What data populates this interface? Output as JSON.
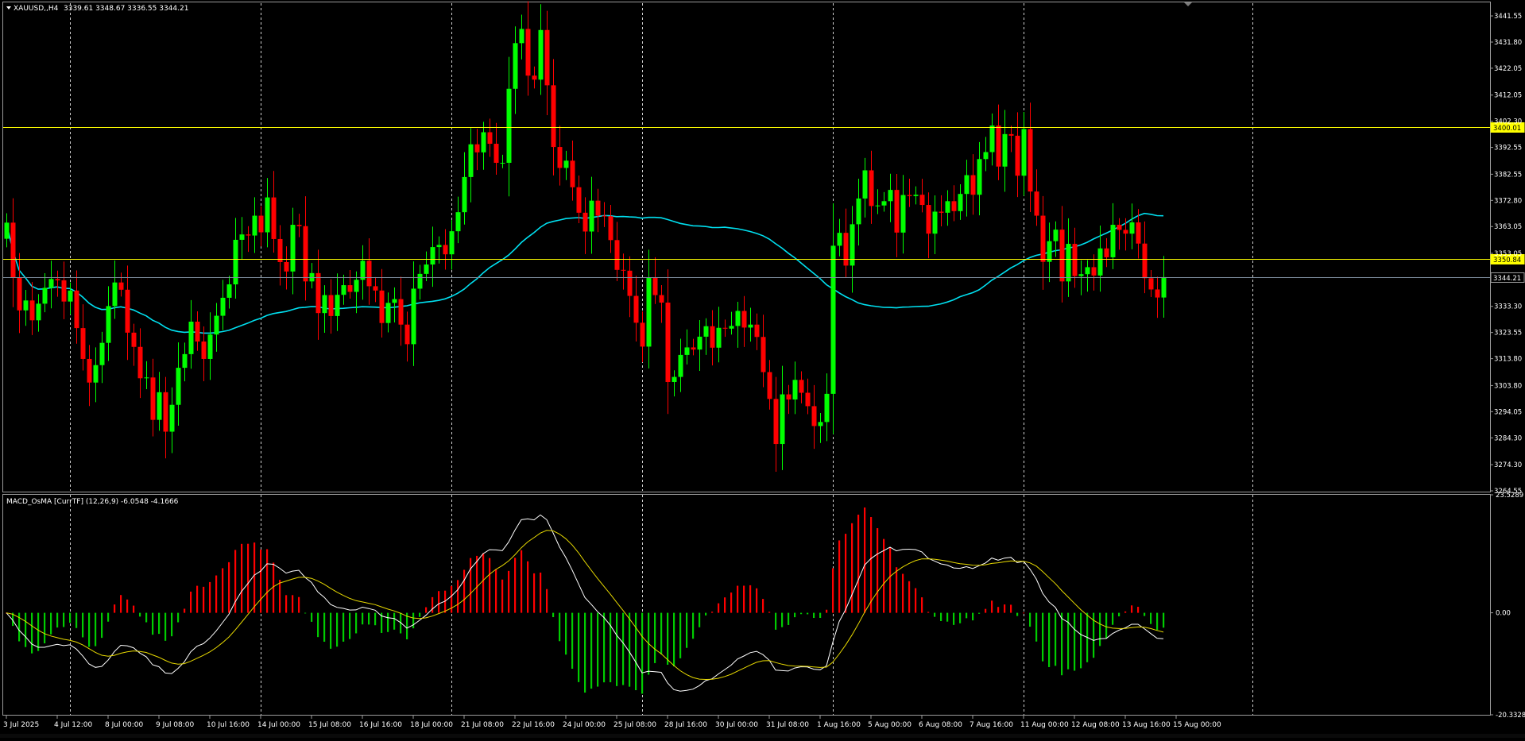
{
  "window": {
    "symbol_title": "XAUUSD,,H4",
    "ohlc_readout": "3339.61 3348.67 3336.55 3344.21"
  },
  "indicator": {
    "title": "MACD_OsMA [CurrTF] (12,26,9) -6.0548 -4.1666"
  },
  "colors": {
    "background": "#000000",
    "bull_candle": "#00ff00",
    "bear_candle": "#ff0000",
    "moving_average": "#00e0f0",
    "level_line": "#ffff00",
    "current_price_line": "#7d8d9d",
    "macd_line": "#ffffff",
    "signal_line": "#e6d800",
    "hist_positive": "#ff0000",
    "hist_negative": "#00cc00",
    "grid": "#cfcfcf",
    "axis_text": "#ffffff"
  },
  "chart_data": [
    {
      "type": "candlestick",
      "ylim": [
        3264.55,
        3446.3
      ],
      "ticks": [
        3441.55,
        3431.8,
        3422.05,
        3412.05,
        3402.3,
        3392.55,
        3382.55,
        3372.8,
        3363.05,
        3353.05,
        3333.3,
        3323.55,
        3313.8,
        3303.8,
        3294.05,
        3284.3,
        3274.3,
        3264.55
      ],
      "tick_labels": [
        "3441.55",
        "3431.80",
        "3422.05",
        "3412.05",
        "3402.30",
        "3392.55",
        "3382.55",
        "3372.80",
        "3363.05",
        "3353.05",
        "3333.30",
        "3323.55",
        "3313.80",
        "3303.80",
        "3294.05",
        "3284.30",
        "3274.30",
        "3264.55"
      ],
      "price_labels": [
        {
          "value": 3400.01,
          "text": "3400.01",
          "style": "level"
        },
        {
          "value": 3350.84,
          "text": "3350.84",
          "style": "level"
        },
        {
          "value": 3344.21,
          "text": "3344.21",
          "style": "current"
        }
      ],
      "x_labels": [
        "3 Jul 2025",
        "4 Jul 12:00",
        "8 Jul 00:00",
        "9 Jul 08:00",
        "10 Jul 16:00",
        "14 Jul 00:00",
        "15 Jul 08:00",
        "16 Jul 16:00",
        "18 Jul 00:00",
        "21 Jul 08:00",
        "22 Jul 16:00",
        "24 Jul 00:00",
        "25 Jul 08:00",
        "28 Jul 16:00",
        "30 Jul 00:00",
        "31 Jul 08:00",
        "1 Aug 16:00",
        "5 Aug 00:00",
        "6 Aug 08:00",
        "7 Aug 16:00",
        "11 Aug 00:00",
        "12 Aug 08:00",
        "13 Aug 16:00",
        "15 Aug 00:00"
      ],
      "x_label_bars": [
        0,
        8,
        16,
        24,
        32,
        40,
        48,
        56,
        64,
        72,
        80,
        88,
        96,
        104,
        112,
        120,
        128,
        136,
        144,
        152,
        160,
        168,
        176,
        184
      ],
      "grid_bars": [
        10,
        40,
        70,
        100,
        130,
        160,
        196
      ],
      "total_slots": 239,
      "bar_count": 186,
      "closes": [
        3364.5,
        3344.1,
        3331.8,
        3335.5,
        3328.1,
        3334.3,
        3340.2,
        3343.5,
        3343.0,
        3335.1,
        3339.2,
        3325.2,
        3313.7,
        3304.9,
        3311.4,
        3319.7,
        3333.4,
        3342.2,
        3339.5,
        3323.5,
        3318.2,
        3306.5,
        3306.8,
        3291.0,
        3301.3,
        3286.6,
        3296.6,
        3310.4,
        3315.5,
        3327.6,
        3320.2,
        3313.7,
        3322.8,
        3329.8,
        3336.5,
        3341.5,
        3358.1,
        3360.1,
        3359.7,
        3367.1,
        3360.9,
        3373.9,
        3358.4,
        3349.8,
        3346.3,
        3363.7,
        3363.2,
        3342.6,
        3345.7,
        3330.8,
        3337.5,
        3329.7,
        3337.6,
        3341.2,
        3338.7,
        3343.2,
        3350.3,
        3340.8,
        3339.2,
        3327.1,
        3334.6,
        3336.0,
        3326.5,
        3319.2,
        3339.9,
        3345.4,
        3348.9,
        3355.4,
        3356.2,
        3352.7,
        3361.3,
        3368.4,
        3381.5,
        3393.7,
        3390.7,
        3398.2,
        3393.9,
        3386.8,
        3386.8,
        3414.4,
        3431.4,
        3436.7,
        3419.3,
        3417.8,
        3436.3,
        3415.7,
        3392.7,
        3384.9,
        3387.6,
        3377.7,
        3368.2,
        3361.2,
        3372.7,
        3367.1,
        3366.9,
        3358.0,
        3346.9,
        3346.6,
        3337.2,
        3327.2,
        3318.3,
        3344.0,
        3337.5,
        3334.7,
        3305.1,
        3307.0,
        3315.2,
        3318.0,
        3317.2,
        3322.0,
        3325.9,
        3317.9,
        3325.3,
        3325.0,
        3326.0,
        3331.6,
        3325.4,
        3326.5,
        3321.9,
        3308.8,
        3298.8,
        3282.0,
        3300.5,
        3298.6,
        3305.9,
        3301.1,
        3296.1,
        3288.7,
        3290.2,
        3300.7,
        3355.9,
        3360.7,
        3348.5,
        3363.9,
        3373.5,
        3384.0,
        3370.7,
        3370.9,
        3372.5,
        3376.7,
        3360.8,
        3374.8,
        3374.4,
        3374.9,
        3371.1,
        3360.4,
        3368.6,
        3368.2,
        3372.5,
        3368.8,
        3375.2,
        3382.2,
        3374.9,
        3388.2,
        3390.8,
        3400.7,
        3385.4,
        3397.5,
        3396.9,
        3382.0,
        3399.4,
        3376.1,
        3367.1,
        3349.9,
        3357.6,
        3361.9,
        3342.6,
        3356.6,
        3344.6,
        3345.3,
        3347.9,
        3344.8,
        3354.9,
        3351.6,
        3363.7,
        3361.8,
        3360.4,
        3364.6,
        3356.7,
        3343.8,
        3339.6,
        3336.6,
        3344.2
      ]
    },
    {
      "type": "bar+line",
      "ylim": [
        -20.3328,
        23.5289
      ],
      "tick_labels": [
        "23.5289",
        "0.00",
        "-20.3328"
      ],
      "ticks": [
        23.5289,
        0,
        -20.3328
      ]
    }
  ]
}
